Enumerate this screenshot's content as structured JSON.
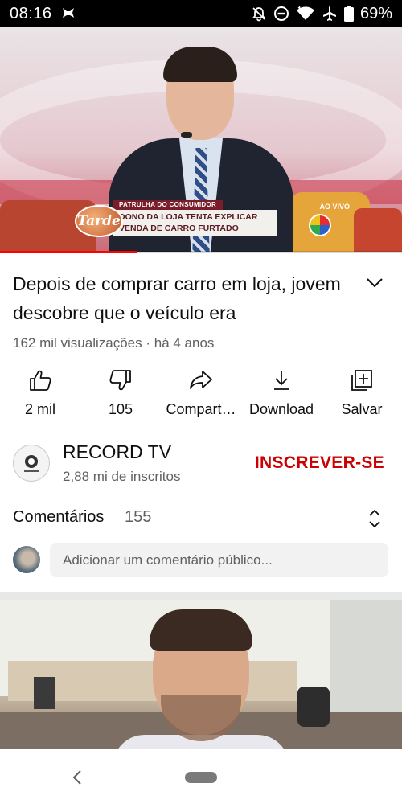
{
  "status_bar": {
    "time": "08:16",
    "battery": "69%",
    "icons": [
      "notification-app-icon",
      "bell-off-icon",
      "do-not-disturb-icon",
      "wifi-icon",
      "airplane-icon",
      "battery-icon"
    ]
  },
  "player": {
    "lower_third": {
      "show_logo": "Tarde",
      "kicker": "PATRULHA DO CONSUMIDOR",
      "headline_line1": "DONO DA LOJA TENTA EXPLICAR",
      "headline_line2": "VENDA DE CARRO FURTADO"
    },
    "live_label": "AO VIVO",
    "progress_fraction": 0.34,
    "progress_color": "#ff0000"
  },
  "video": {
    "title": "Depois de comprar carro em loja, jovem descobre que o veículo era",
    "meta": "162 mil visualizações · há 4 anos"
  },
  "actions": [
    {
      "label": "2 mil",
      "icon": "thumbs-up-icon"
    },
    {
      "label": "105",
      "icon": "thumbs-down-icon"
    },
    {
      "label": "Compart…",
      "icon": "share-icon"
    },
    {
      "label": "Download",
      "icon": "download-icon"
    },
    {
      "label": "Salvar",
      "icon": "save-playlist-icon"
    }
  ],
  "channel": {
    "name": "RECORD TV",
    "subscribers": "2,88 mi de inscritos",
    "subscribe_label": "INSCREVER-SE",
    "subscribe_color": "#cc0000"
  },
  "comments": {
    "header": "Comentários",
    "count": "155",
    "placeholder": "Adicionar um comentário público..."
  },
  "nav": {
    "icons": [
      "back-icon",
      "home-pill-icon"
    ]
  }
}
